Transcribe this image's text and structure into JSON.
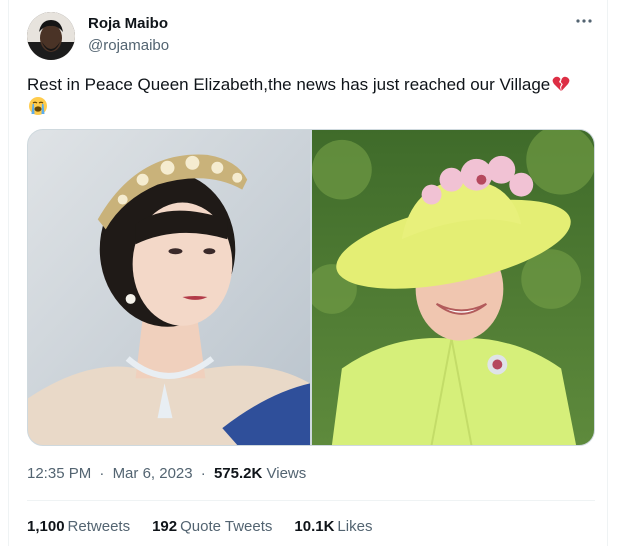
{
  "author": {
    "name": "Roja Maibo",
    "handle": "@rojamaibo"
  },
  "tweet": {
    "text": "Rest in Peace Queen Elizabeth,the news has just reached our Village",
    "emojis": [
      "broken-heart-emoji",
      "loudly-crying-face-emoji"
    ]
  },
  "media": {
    "photos": [
      "queen-portrait-tiara",
      "queen-yellow-hat"
    ]
  },
  "meta": {
    "time": "12:35 PM",
    "separator": "·",
    "date": "Mar 6, 2023",
    "views_count": "575.2K",
    "views_label": "Views"
  },
  "stats": {
    "retweets_count": "1,100",
    "retweets_label": "Retweets",
    "quotes_count": "192",
    "quotes_label": "Quote Tweets",
    "likes_count": "10.1K",
    "likes_label": "Likes"
  },
  "colors": {
    "text": "#0f1419",
    "secondary": "#536471",
    "border": "#cfd9de"
  }
}
